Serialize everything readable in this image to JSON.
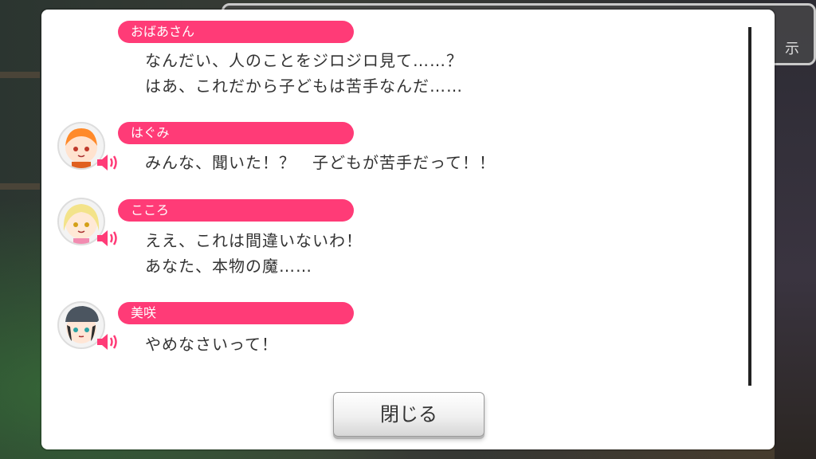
{
  "background": {
    "tab_text": "示"
  },
  "log": {
    "entries": [
      {
        "speaker": "おばあさん",
        "lines": [
          "なんだい、人のことをジロジロ見て……？",
          "はあ、これだから子どもは苦手なんだ……"
        ],
        "avatar": null
      },
      {
        "speaker": "はぐみ",
        "lines": [
          "みんな、聞いた！？　子どもが苦手だって！！"
        ],
        "avatar": "avatar-hagumi"
      },
      {
        "speaker": "こころ",
        "lines": [
          "ええ、これは間違いないわ！",
          "あなた、本物の魔……"
        ],
        "avatar": "avatar-kokoro"
      },
      {
        "speaker": "美咲",
        "lines": [
          "やめなさいって！"
        ],
        "avatar": "avatar-misaki"
      }
    ]
  },
  "close_label": "閉じる",
  "colors": {
    "accent": "#ff3b77",
    "text": "#333333"
  },
  "icons": {
    "voice": "speaker-icon"
  }
}
